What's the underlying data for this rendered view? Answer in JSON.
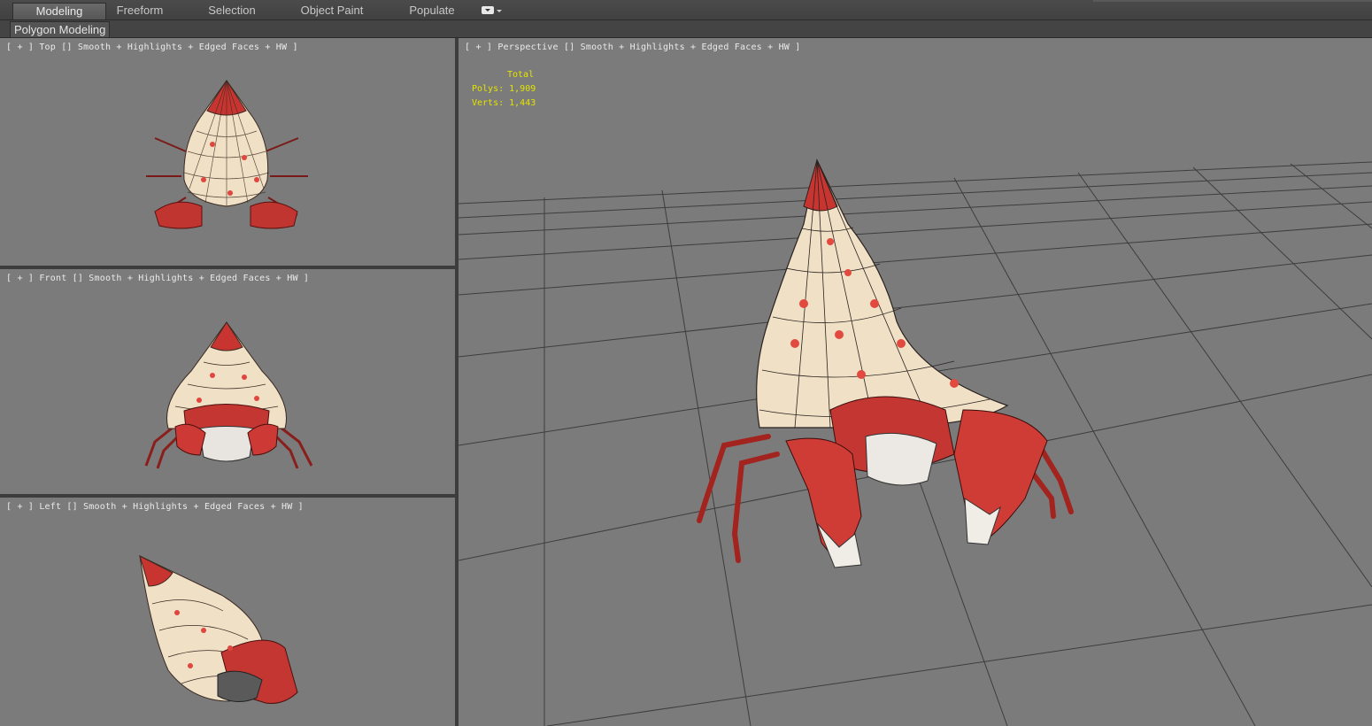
{
  "ribbon": {
    "tabs": [
      {
        "label": "Modeling",
        "active": true
      },
      {
        "label": "Freeform",
        "active": false
      },
      {
        "label": "Selection",
        "active": false
      },
      {
        "label": "Object Paint",
        "active": false
      },
      {
        "label": "Populate",
        "active": false
      }
    ],
    "options_icon": "dropdown-options-icon",
    "panel_label": "Polygon Modeling"
  },
  "viewports": {
    "top": {
      "label": "[ + ] Top [] Smooth + Highlights + Edged Faces + HW ]"
    },
    "front": {
      "label": "[ + ] Front [] Smooth + Highlights + Edged Faces + HW ]"
    },
    "left": {
      "label": "[ + ] Left [] Smooth + Highlights + Edged Faces + HW ]"
    },
    "perspective": {
      "label": "[ + ] Perspective [] Smooth + Highlights + Edged Faces + HW ]"
    }
  },
  "stats": {
    "total_label": "Total",
    "polys": "Polys: 1,909",
    "verts": "Verts: 1,443"
  },
  "colors": {
    "viewport_bg": "#7b7b7b",
    "shell": "#efe0c6",
    "crab_red": "#c8342f",
    "stats_yellow": "#e4e400"
  }
}
